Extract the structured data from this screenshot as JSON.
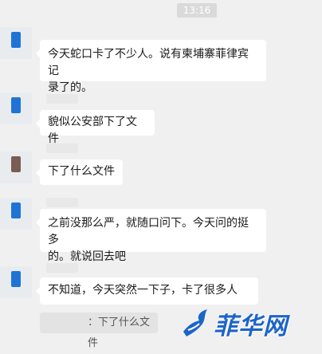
{
  "chat": {
    "timestamp": "13:16",
    "messages": [
      {
        "text": "今天蛇口卡了不少人。说有柬埔寨菲律宾记\n录了的。"
      },
      {
        "text": "貌似公安部下了文件"
      },
      {
        "text": "下了什么文件"
      },
      {
        "text": "之前没那么严，就随口问下。今天问的挺多\n的。就说回去吧"
      },
      {
        "text": "不知道，今天突然一下子，卡了很多人"
      }
    ],
    "quote": {
      "text": "：下了什么文件"
    }
  },
  "watermark": {
    "text": "菲华网",
    "color": "#1d64c8"
  },
  "colors": {
    "background": "#f0f0f0",
    "bubble": "#ffffff",
    "avatar_blue": "#1f73d6"
  }
}
